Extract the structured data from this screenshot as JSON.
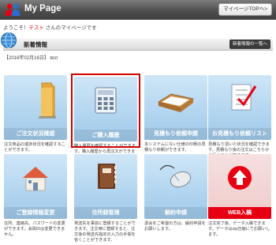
{
  "header": {
    "title": "My Page",
    "top_button": "マイページTOPへ>"
  },
  "welcome": {
    "prefix": "ようこそ！",
    "user": "テスト",
    "suffix": " さんのマイページです"
  },
  "section": {
    "title": "新着情報",
    "list_button": "新着情報の一覧へ"
  },
  "news": {
    "date": "【2016年02月16日】",
    "text": "test"
  },
  "tiles": [
    {
      "label": "ご注文状況確認",
      "desc": "注文商品の進捗状況を確認することができます。",
      "icon": "folder-icon"
    },
    {
      "label": "ご購入履歴",
      "desc": "購入履歴を確認することができます。購入履歴から再注文ができません。",
      "icon": "calculator-icon"
    },
    {
      "label": "見積もり依頼申請",
      "desc": "本システムにない仕様の印刷の見積もり依頼ができます。",
      "icon": "tray-icon"
    },
    {
      "label": "お見積もり依頼リスト",
      "desc": "見積もり頂いた状況を確認できます。見積もり後の注文はこちらから行うことができます。",
      "icon": "checklist-icon"
    },
    {
      "label": "ご登録情報変更",
      "desc": "住所、連絡先、パスワードの変更ができます。会員IDは変更できません。",
      "icon": "house-icon"
    },
    {
      "label": "住所録管理",
      "desc": "発送先を事前に登録することができます。注文時に登録すると、注文後の発送先指定の入力の手間を省くことができます。",
      "icon": "address-book-icon"
    },
    {
      "label": "解約申請",
      "desc": "退会をご希望の方は、解約申請をお願いします。",
      "icon": "mouse-icon"
    },
    {
      "label": "WEB入稿",
      "desc": "注文完了後、データ入稿できます。データはzip圧縮にてお願いします。",
      "icon": "upload-arrow-icon"
    }
  ],
  "colors": {
    "accent": "#e60012",
    "tile_blue": "#9ec9ea",
    "header_dark": "#4e4e4e"
  }
}
